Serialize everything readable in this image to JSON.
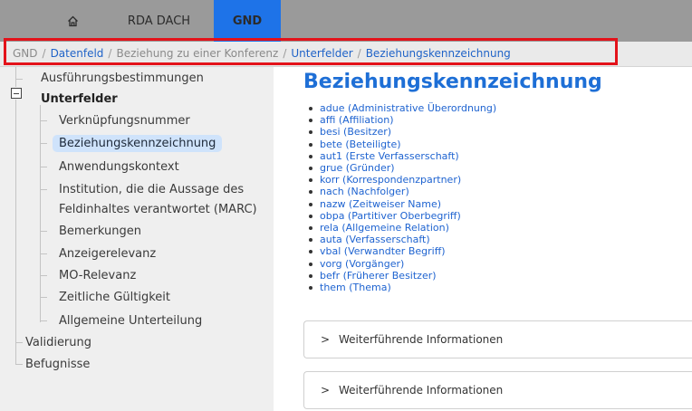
{
  "topnav": {
    "tabs": [
      {
        "label": "",
        "icon": "home-icon"
      },
      {
        "label": "RDA DACH"
      },
      {
        "label": "GND",
        "active": true
      }
    ]
  },
  "breadcrumb": [
    {
      "label": "GND",
      "link": false
    },
    {
      "label": "Datenfeld",
      "link": true
    },
    {
      "label": "Beziehung zu einer Konferenz",
      "link": false
    },
    {
      "label": "Unterfelder",
      "link": true
    },
    {
      "label": "Beziehungskennzeichnung",
      "link": true
    }
  ],
  "sidebar": {
    "items": [
      {
        "label": "Ausführungsbestimmungen"
      },
      {
        "label": "Unterfelder",
        "bold": true,
        "expanded": true
      },
      {
        "label": "Verknüpfungsnummer"
      },
      {
        "label": "Beziehungskennzeichnung",
        "active": true
      },
      {
        "label": "Anwendungskontext"
      },
      {
        "label": "Institution, die die Aussage des"
      },
      {
        "label": "Feldinhaltes verantwortet (MARC)"
      },
      {
        "label": "Bemerkungen"
      },
      {
        "label": "Anzeigerelevanz"
      },
      {
        "label": "MO-Relevanz"
      },
      {
        "label": "Zeitliche Gültigkeit"
      },
      {
        "label": "Allgemeine Unterteilung"
      },
      {
        "label": "Validierung"
      },
      {
        "label": "Befugnisse"
      }
    ]
  },
  "main": {
    "title": "Beziehungskennzeichnung",
    "values": [
      "adue (Administrative Überordnung)",
      "affi (Affiliation)",
      "besi (Besitzer)",
      "bete (Beteiligte)",
      "aut1 (Erste Verfasserschaft)",
      "grue (Gründer)",
      "korr (Korrespondenzpartner)",
      "nach (Nachfolger)",
      "nazw (Zeitweiser Name)",
      "obpa (Partitiver Oberbegriff)",
      "rela (Allgemeine Relation)",
      "auta (Verfasserschaft)",
      "vbal (Verwandter Begriff)",
      "vorg (Vorgänger)",
      "befr (Früherer Besitzer)",
      "them (Thema)"
    ],
    "accordions": [
      {
        "label": "Weiterführende Informationen",
        "chevron": ">"
      },
      {
        "label": "Weiterführende Informationen",
        "chevron": ">"
      }
    ]
  },
  "colors": {
    "accent": "#1e73e8",
    "link": "#1e63d0",
    "highlight_box": "#e3121a",
    "active_item_bg": "#cfe3fb"
  }
}
